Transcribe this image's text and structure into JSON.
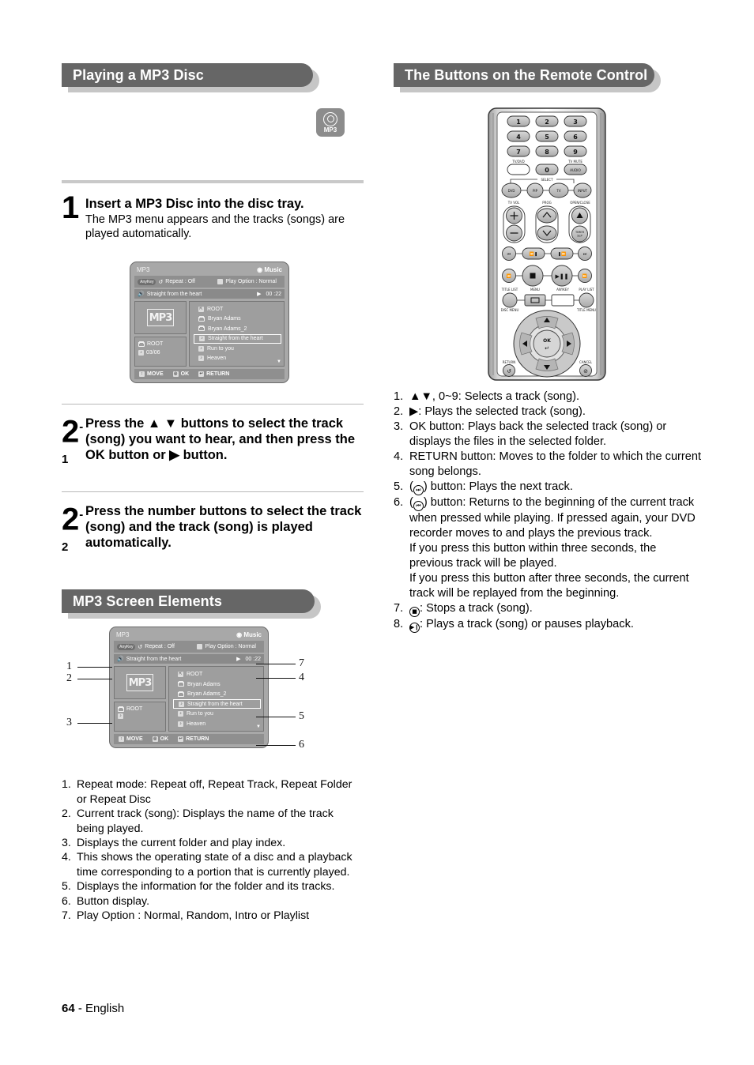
{
  "page": {
    "number": "64",
    "language": "English",
    "footer_separator": "-"
  },
  "left_column": {
    "section_title": "Playing a MP3 Disc",
    "disc_badge": {
      "icon": "mp3-disc-icon",
      "label": "MP3"
    },
    "step1": {
      "number": "1",
      "title": "Insert a MP3 Disc into the disc tray.",
      "desc": "The MP3 menu appears and the tracks (songs) are played automatically."
    },
    "step2_1": {
      "number": "2",
      "sup": "-1",
      "title": "Press the ▲ ▼ buttons to select the track (song) you want to hear, and then press the OK button or ▶ button."
    },
    "step2_2": {
      "number": "2",
      "sup": "-2",
      "title": "Press the number buttons to select the track (song) and the track (song) is played automatically."
    },
    "section_title2": "MP3 Screen Elements",
    "elements_list": [
      {
        "n": "1.",
        "text": "Repeat mode: Repeat off, Repeat Track, Repeat Folder or Repeat Disc"
      },
      {
        "n": "2.",
        "text": "Current track (song): Displays the name of the track being played."
      },
      {
        "n": "3.",
        "text": "Displays the current folder and play index."
      },
      {
        "n": "4.",
        "text": "This shows the operating state of a disc and a playback time corresponding to a portion that is currently played."
      },
      {
        "n": "5.",
        "text": "Displays the information for the folder and its tracks."
      },
      {
        "n": "6.",
        "text": "Button display."
      },
      {
        "n": "7.",
        "text": "Play Option : Normal, Random, Intro or Playlist"
      }
    ]
  },
  "osd": {
    "title": "MP3",
    "mode_icon": "music-note-icon",
    "mode": "Music",
    "anykey_pill": "AnyKey",
    "repeat_icon": "repeat-icon",
    "repeat_label": "Repeat : Off",
    "playoption_icon": "play-option-icon",
    "playoption_label": "Play Option : Normal",
    "now_icon": "speaker-icon",
    "now_playing": "Straight from the heart",
    "play_state_icon": "play-icon",
    "elapsed": "00 :22",
    "art_logo": "MP3",
    "current_folder_icon": "folder-icon",
    "current_folder": "ROOT",
    "track_index_icon": "note-icon",
    "track_index": "03/06",
    "files": [
      {
        "icon": "folder-up-icon",
        "name": "ROOT",
        "selected": false
      },
      {
        "icon": "folder-icon",
        "name": "Bryan Adams",
        "selected": false
      },
      {
        "icon": "folder-icon",
        "name": "Bryan Adams_2",
        "selected": false
      },
      {
        "icon": "note-icon",
        "name": "Straight from the heart",
        "selected": true
      },
      {
        "icon": "note-icon",
        "name": "Run to you",
        "selected": false
      },
      {
        "icon": "note-icon",
        "name": "Heaven",
        "selected": false
      }
    ],
    "scroll_icon": "chevron-down-icon",
    "buttons": [
      {
        "icon": "updown-icon",
        "label": "MOVE"
      },
      {
        "icon": "ok-icon",
        "label": "OK"
      },
      {
        "icon": "return-icon",
        "label": "RETURN"
      }
    ]
  },
  "callouts": [
    {
      "id": "1",
      "side": "left",
      "label": "1"
    },
    {
      "id": "2",
      "side": "left",
      "label": "2"
    },
    {
      "id": "3",
      "side": "left",
      "label": "3"
    },
    {
      "id": "7",
      "side": "right",
      "label": "7"
    },
    {
      "id": "4",
      "side": "right",
      "label": "4"
    },
    {
      "id": "5",
      "side": "right",
      "label": "5"
    },
    {
      "id": "6",
      "side": "right",
      "label": "6"
    }
  ],
  "right_column": {
    "section_title": "The Buttons on the Remote Control",
    "remote": {
      "numbers": [
        "1",
        "2",
        "3",
        "4",
        "5",
        "6",
        "7",
        "8",
        "9",
        "0"
      ],
      "tv_dvd_label": "TV/DVD",
      "tv_mute_label": "TV MUTE",
      "audio_label": "AUDIO",
      "select_label": "SELECT",
      "select_buttons": [
        "DVD",
        "PIP",
        "TV"
      ],
      "input_label": "INPUT",
      "tv_vol_label": "TV VOL",
      "prog_label": "PROG",
      "open_close_label": "OPEN/CLOSE",
      "timer_label": "TIMER SLP",
      "title_list_label": "TITLE LIST",
      "menu_label": "MENU",
      "anykey_label": "ANYKEY",
      "play_list_label": "PLAY LIST",
      "disc_menu_label": "DISC MENU",
      "title_menu_label": "TITLE MENU",
      "ok_label": "OK",
      "return_label": "RETURN",
      "cancel_label": "CANCEL"
    },
    "buttons_list": [
      {
        "n": "1.",
        "text": "▲▼, 0~9: Selects a track (song)."
      },
      {
        "n": "2.",
        "text": "▶: Plays the selected track (song)."
      },
      {
        "n": "3.",
        "text": "OK button: Plays back the selected track (song) or displays the files in the selected folder."
      },
      {
        "n": "4.",
        "text": "RETURN button: Moves to the folder to which the current song belongs."
      },
      {
        "n": "5.",
        "glyph": "skip-next-icon",
        "text": ") button: Plays the next track.",
        "prefix": "("
      },
      {
        "n": "6.",
        "glyph": "skip-prev-icon",
        "text": ") button: Returns to the beginning of the current track when pressed while playing. If pressed again, your DVD recorder moves to and plays the previous track.",
        "prefix": "("
      },
      {
        "n": "",
        "text": "If you press this button within three seconds, the previous track will be played."
      },
      {
        "n": "",
        "text": "If you press this button after three seconds, the current track will be replayed from the beginning."
      },
      {
        "n": "7.",
        "glyph": "stop-icon",
        "text": ": Stops a track (song).",
        "prefix": ""
      },
      {
        "n": "8.",
        "glyph": "play-pause-icon",
        "text": ": Plays a track (song) or pauses playback.",
        "prefix": ""
      }
    ]
  },
  "colors": {
    "header_bar": "#666666",
    "header_shadow": "#c6c6c6",
    "osd_bg": "#a8a8a8",
    "rule": "#c9c9c9"
  }
}
